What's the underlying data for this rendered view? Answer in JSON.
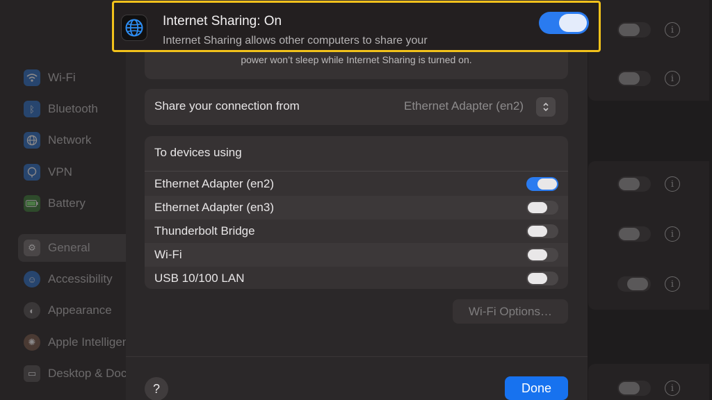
{
  "sidebar": {
    "items": [
      {
        "label": "Wi-Fi",
        "icon": "wifi-icon"
      },
      {
        "label": "Bluetooth",
        "icon": "bluetooth-icon"
      },
      {
        "label": "Network",
        "icon": "globe-icon"
      },
      {
        "label": "VPN",
        "icon": "vpn-icon"
      },
      {
        "label": "Battery",
        "icon": "battery-icon"
      },
      {
        "label": "General",
        "icon": "gear-icon",
        "selected": true
      },
      {
        "label": "Accessibility",
        "icon": "accessibility-icon"
      },
      {
        "label": "Appearance",
        "icon": "appearance-icon"
      },
      {
        "label": "Apple Intelligence",
        "icon": "apple-intelligence-icon"
      },
      {
        "label": "Desktop & Dock",
        "icon": "desktop-dock-icon"
      }
    ]
  },
  "header": {
    "title": "Internet Sharing: On",
    "subtitle": "Internet Sharing allows other computers to share your",
    "enabled": true
  },
  "note": {
    "text": "power won’t sleep while Internet Sharing is turned on."
  },
  "share_from": {
    "label": "Share your connection from",
    "value": "Ethernet Adapter (en2)"
  },
  "devices": {
    "header": "To devices using",
    "items": [
      {
        "label": "Ethernet Adapter (en2)",
        "enabled": true
      },
      {
        "label": "Ethernet Adapter (en3)",
        "enabled": false
      },
      {
        "label": "Thunderbolt Bridge",
        "enabled": false
      },
      {
        "label": "Wi-Fi",
        "enabled": false
      },
      {
        "label": "USB 10/100 LAN",
        "enabled": false
      }
    ]
  },
  "buttons": {
    "wifi_options": "Wi-Fi Options…",
    "help": "?",
    "done": "Done"
  },
  "colors": {
    "accent": "#1772ef",
    "highlight_border": "#f2c21b"
  }
}
